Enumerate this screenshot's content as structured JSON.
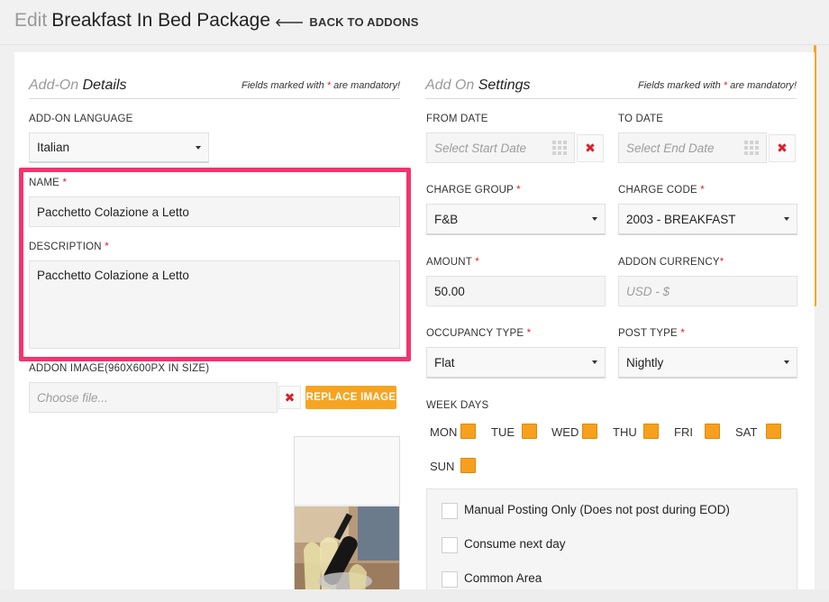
{
  "header": {
    "title_prefix": "Edit",
    "title": "Breakfast In Bed Package",
    "back_label": "BACK TO ADDONS"
  },
  "details": {
    "title_muted": "Add-On",
    "title_main": "Details",
    "mandatory_prefix": "Fields marked with",
    "mandatory_star": "*",
    "mandatory_suffix": "are mandatory!",
    "language_label": "ADD-ON LANGUAGE",
    "language_value": "Italian",
    "name_label": "NAME",
    "name_value": "Pacchetto Colazione a Letto",
    "description_label": "DESCRIPTION",
    "description_value": "Pacchetto Colazione a Letto",
    "image_label": "ADDON IMAGE(960X600PX IN SIZE)",
    "file_placeholder": "Choose file...",
    "replace_label": "REPLACE IMAGE"
  },
  "settings": {
    "title_muted": "Add On",
    "title_main": "Settings",
    "mandatory_prefix": "Fields marked with",
    "mandatory_star": "*",
    "mandatory_suffix": "are mandatory!",
    "from_date_label": "FROM DATE",
    "from_date_placeholder": "Select Start Date",
    "to_date_label": "TO DATE",
    "to_date_placeholder": "Select End Date",
    "charge_group_label": "CHARGE GROUP",
    "charge_group_value": "F&B",
    "charge_code_label": "CHARGE CODE",
    "charge_code_value": "2003 - BREAKFAST",
    "amount_label": "AMOUNT",
    "amount_value": "50.00",
    "currency_label": "ADDON CURRENCY",
    "currency_placeholder": "USD - $",
    "occupancy_label": "OCCUPANCY TYPE",
    "occupancy_value": "Flat",
    "post_type_label": "POST TYPE",
    "post_type_value": "Nightly",
    "week_days_label": "WEEK DAYS",
    "days": [
      "MON",
      "TUE",
      "WED",
      "THU",
      "FRI",
      "SAT",
      "SUN"
    ],
    "options": [
      "Manual Posting Only (Does not post during EOD)",
      "Consume next day",
      "Common Area"
    ]
  },
  "icons": {
    "back": "arrow-left-icon",
    "calendar": "calendar-grid-icon",
    "clear": "close-x-icon",
    "dropdown": "caret-down-icon"
  },
  "colors": {
    "accent": "#f6a522",
    "required": "#e0202f",
    "highlight": "#f5336d",
    "clear_x": "#d9232d"
  }
}
